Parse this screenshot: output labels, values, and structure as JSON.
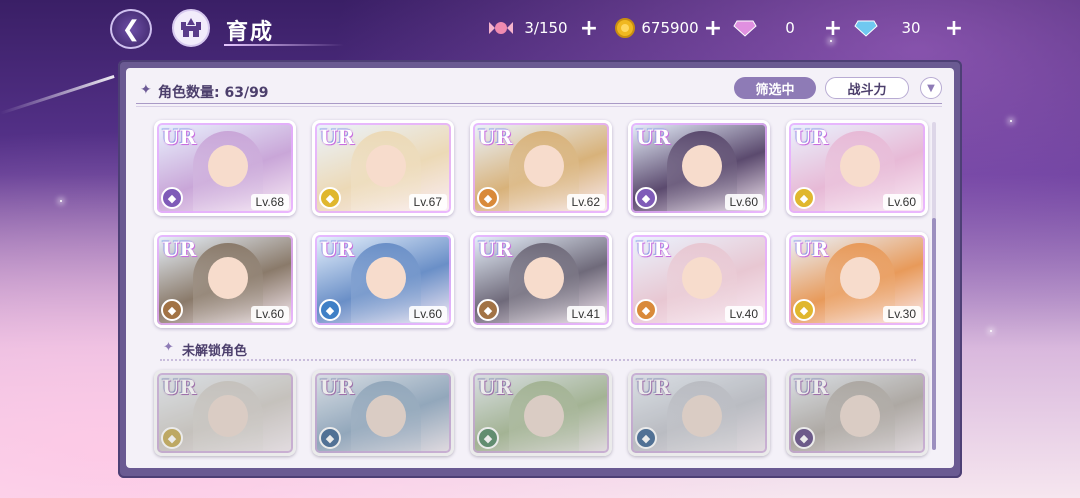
{
  "header": {
    "title": "育成"
  },
  "resources": [
    {
      "icon": "candy-icon",
      "value": "3/150",
      "color": "#f08bb0"
    },
    {
      "icon": "gold-coin-icon",
      "value": "675900",
      "color": "#f0b820"
    },
    {
      "icon": "pink-diamond-icon",
      "value": "0",
      "color": "#e090e0"
    },
    {
      "icon": "blue-diamond-icon",
      "value": "30",
      "color": "#70c8f0"
    }
  ],
  "panel": {
    "count_label": "角色数量: 63/99",
    "filter_label": "筛选中",
    "sort_label": "战斗力",
    "locked_section_label": "未解锁角色"
  },
  "rarity_label": "UR",
  "characters_owned": [
    {
      "level": "Lv.68",
      "element": "purple",
      "art": "#c9a6d8"
    },
    {
      "level": "Lv.67",
      "element": "yellow",
      "art": "#ecd9b6"
    },
    {
      "level": "Lv.62",
      "element": "orange",
      "art": "#d8b27a"
    },
    {
      "level": "Lv.60",
      "element": "purple",
      "art": "#5b4a6e"
    },
    {
      "level": "Lv.60",
      "element": "yellow",
      "art": "#e7b9d6"
    },
    {
      "level": "Lv.60",
      "element": "brown",
      "art": "#8a7a6a"
    },
    {
      "level": "Lv.60",
      "element": "blue",
      "art": "#6a8fc7"
    },
    {
      "level": "Lv.41",
      "element": "brown",
      "art": "#6f6a7a"
    },
    {
      "level": "Lv.40",
      "element": "orange",
      "art": "#e8c7d2"
    },
    {
      "level": "Lv.30",
      "element": "yellow",
      "art": "#e89a5a"
    }
  ],
  "characters_locked": [
    {
      "element": "yellow",
      "art": "#d9d2c8"
    },
    {
      "element": "blue",
      "art": "#8fb8e0"
    },
    {
      "element": "green",
      "art": "#a8c88a"
    },
    {
      "element": "blue",
      "art": "#c8ccd8"
    },
    {
      "element": "purple",
      "art": "#c0b6ac"
    }
  ],
  "element_colors": {
    "purple": "#7f5bb8",
    "yellow": "#e0b72e",
    "orange": "#d98a3a",
    "brown": "#a27345",
    "blue": "#3f7fc6",
    "green": "#4ea36a"
  }
}
